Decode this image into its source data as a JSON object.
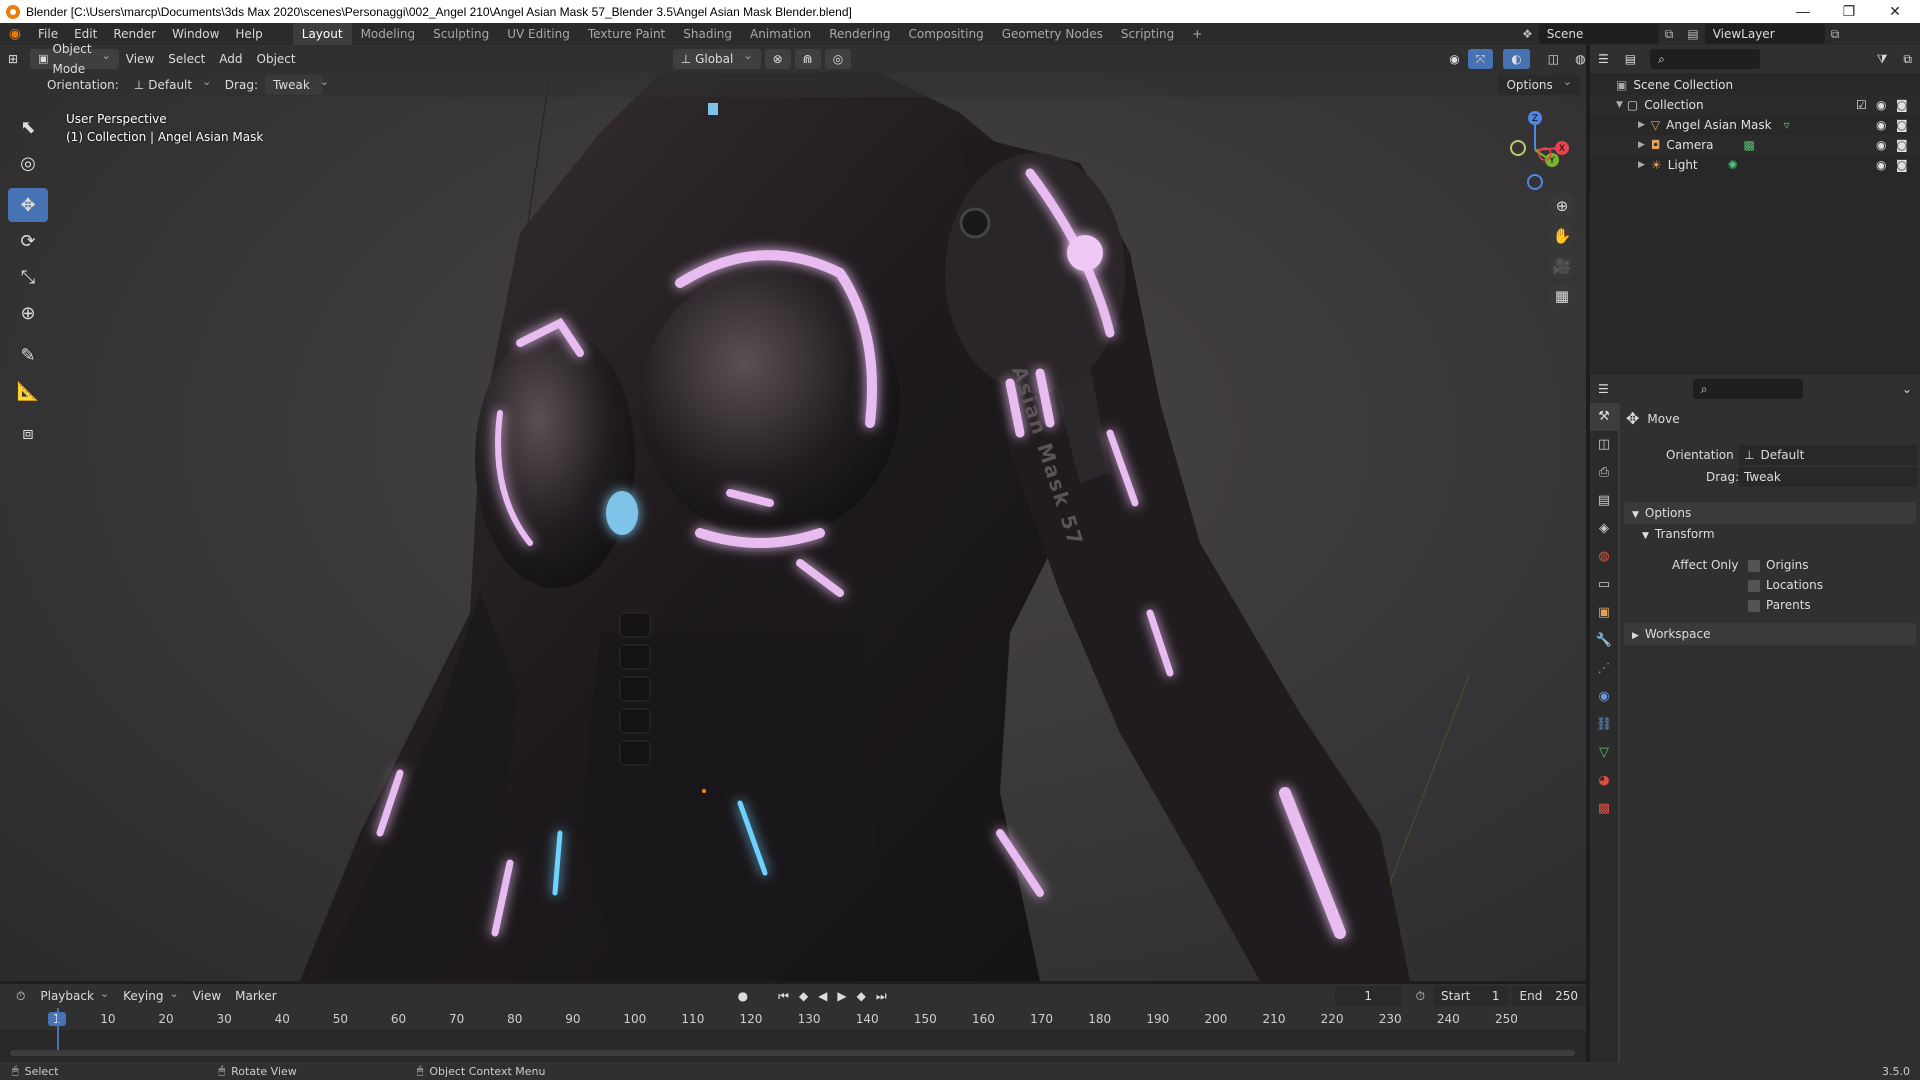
{
  "window": {
    "title": "Blender [C:\\Users\\marcp\\Documents\\3ds Max 2020\\scenes\\Personaggi\\002_Angel 210\\Angel Asian Mask 57_Blender 3.5\\Angel Asian Mask Blender.blend]",
    "minimize": "—",
    "restore": "❐",
    "close": "✕"
  },
  "menu": {
    "items": [
      "File",
      "Edit",
      "Render",
      "Window",
      "Help"
    ],
    "workspaces": [
      "Layout",
      "Modeling",
      "Sculpting",
      "UV Editing",
      "Texture Paint",
      "Shading",
      "Animation",
      "Rendering",
      "Compositing",
      "Geometry Nodes",
      "Scripting"
    ],
    "active_workspace": "Layout",
    "add_tab": "+",
    "scene": "Scene",
    "view_layer": "ViewLayer"
  },
  "viewport_header": {
    "mode": "Object Mode",
    "menus": [
      "View",
      "Select",
      "Add",
      "Object"
    ],
    "transform_orientation": "Global"
  },
  "tool_header": {
    "orientation_label": "Orientation:",
    "orientation_value": "Default",
    "drag_label": "Drag:",
    "drag_value": "Tweak",
    "options": "Options"
  },
  "viewport": {
    "perspective": "User Perspective",
    "collection_info": "(1) Collection | Angel Asian Mask",
    "model_text": "Asian Mask 57",
    "gizmo_labels": {
      "z": "Z",
      "x": "X",
      "y": "Y"
    }
  },
  "outliner": {
    "scene_collection": "Scene Collection",
    "collection": "Collection",
    "objects": [
      {
        "name": "Angel Asian Mask",
        "icon": "mesh-icon",
        "color": "#e3a25b"
      },
      {
        "name": "Camera",
        "icon": "camera-icon",
        "color": "#e3a25b"
      },
      {
        "name": "Light",
        "icon": "light-icon",
        "color": "#e3a25b"
      }
    ]
  },
  "properties": {
    "tool_name": "Move",
    "orientation_label": "Orientation",
    "orientation_value": "Default",
    "drag_label": "Drag:",
    "drag_value": "Tweak",
    "options_panel": "Options",
    "transform_panel": "Transform",
    "affect_only_label": "Affect Only",
    "affect_only_options": [
      "Origins",
      "Locations",
      "Parents"
    ],
    "workspace_panel": "Workspace"
  },
  "timeline": {
    "menus": [
      "Playback",
      "Keying",
      "View",
      "Marker"
    ],
    "current_frame": "1",
    "start_label": "Start",
    "start_value": "1",
    "end_label": "End",
    "end_value": "250",
    "ruler": [
      "1",
      "10",
      "20",
      "30",
      "40",
      "50",
      "60",
      "70",
      "80",
      "90",
      "100",
      "110",
      "120",
      "130",
      "140",
      "150",
      "160",
      "170",
      "180",
      "190",
      "200",
      "210",
      "220",
      "230",
      "240",
      "250"
    ]
  },
  "statusbar": {
    "select": "Select",
    "rotate_view": "Rotate View",
    "context_menu": "Object Context Menu",
    "version": "3.5.0"
  },
  "colors": {
    "accent": "#4772b3",
    "glow": "#e6b6ee",
    "current_frame": "#4772b3"
  }
}
